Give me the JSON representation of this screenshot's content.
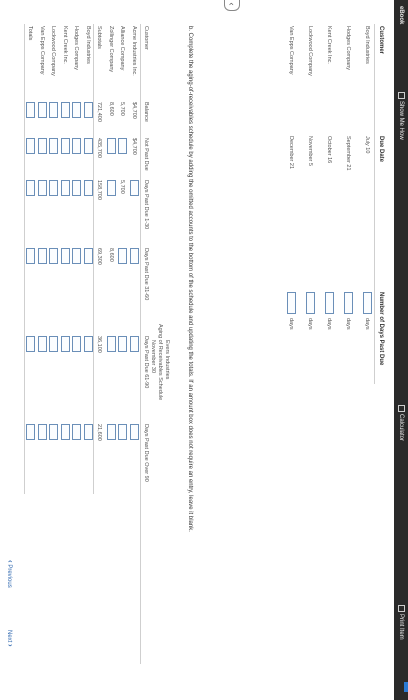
{
  "toolbar": {
    "ebook": "eBook",
    "show_me_how": "Show Me How",
    "calculator": "Calculator",
    "print_item": "Print Item"
  },
  "due_table": {
    "headers": {
      "customer": "Customer",
      "due_date": "Due Date",
      "days_past_due": "Number of Days Past Due"
    },
    "rows": [
      {
        "customer": "Boyd Industries",
        "due_date": "July 10",
        "unit": "days"
      },
      {
        "customer": "Hodges Company",
        "due_date": "September 21",
        "unit": "days"
      },
      {
        "customer": "Kent Creek Inc.",
        "due_date": "October 16",
        "unit": "days"
      },
      {
        "customer": "Lockwood Company",
        "due_date": "November 5",
        "unit": "days"
      },
      {
        "customer": "Van Epps Company",
        "due_date": "December 21",
        "unit": "days"
      }
    ]
  },
  "instructions": "b. Complete the aging-of-receivables schedule by adding the omitted accounts to the bottom of the schedule and updating the totals. If an amount box does not require an entry, leave it blank.",
  "schedule": {
    "title": "Evers Industries",
    "subtitle": "Aging of Receivables Schedule",
    "date": "November 30",
    "columns": [
      "Customer",
      "Balance",
      "Not Past Due",
      "Days Past Due 1-30",
      "Days Past Due 31-60",
      "Days Past Due 61-90",
      "Days Past Due Over 90"
    ],
    "rows": [
      {
        "customer": "Acme Industries Inc.",
        "values": [
          "$4,700",
          "$4,700",
          "",
          "",
          "",
          ""
        ]
      },
      {
        "customer": "Alliance Company",
        "values": [
          "5,700",
          "",
          "5,700",
          "",
          "",
          ""
        ]
      },
      {
        "customer": "Zollinger Company",
        "values": [
          "8,600",
          "",
          "",
          "8,600",
          "",
          ""
        ]
      },
      {
        "customer": "Subtotals",
        "values": [
          "721,400",
          "435,700",
          "158,700",
          "69,300",
          "36,100",
          "21,600"
        ]
      },
      {
        "customer": "Boyd Industries",
        "values": [
          "",
          "",
          "",
          "",
          "",
          ""
        ]
      },
      {
        "customer": "Hodges Company",
        "values": [
          "",
          "",
          "",
          "",
          "",
          ""
        ]
      },
      {
        "customer": "Kent Creek Inc.",
        "values": [
          "",
          "",
          "",
          "",
          "",
          ""
        ]
      },
      {
        "customer": "Lockwood Company",
        "values": [
          "",
          "",
          "",
          "",
          "",
          ""
        ]
      },
      {
        "customer": "Van Epps Company",
        "values": [
          "",
          "",
          "",
          "",
          "",
          ""
        ]
      },
      {
        "customer": "Totals",
        "values": [
          "",
          "",
          "",
          "",
          "",
          ""
        ]
      }
    ]
  },
  "nav": {
    "previous": "Previous",
    "next": "Next"
  }
}
